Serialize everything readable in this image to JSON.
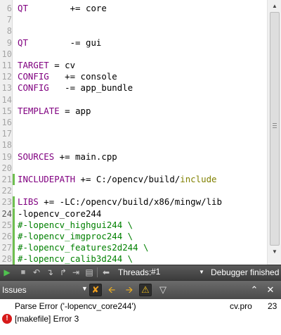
{
  "editor": {
    "lines": [
      {
        "num": "6",
        "segments": [
          {
            "t": "QT",
            "c": "kw"
          },
          {
            "t": "        += core",
            "c": "path"
          }
        ]
      },
      {
        "num": "7",
        "segments": []
      },
      {
        "num": "8",
        "segments": []
      },
      {
        "num": "9",
        "segments": [
          {
            "t": "QT",
            "c": "kw"
          },
          {
            "t": "        -= gui",
            "c": "path"
          }
        ]
      },
      {
        "num": "10",
        "segments": []
      },
      {
        "num": "11",
        "segments": [
          {
            "t": "TARGET",
            "c": "kw"
          },
          {
            "t": " = cv",
            "c": "path"
          }
        ]
      },
      {
        "num": "12",
        "segments": [
          {
            "t": "CONFIG",
            "c": "kw"
          },
          {
            "t": "   += console",
            "c": "path"
          }
        ]
      },
      {
        "num": "13",
        "segments": [
          {
            "t": "CONFIG",
            "c": "kw"
          },
          {
            "t": "   -= app_bundle",
            "c": "path"
          }
        ]
      },
      {
        "num": "14",
        "segments": []
      },
      {
        "num": "15",
        "segments": [
          {
            "t": "TEMPLATE",
            "c": "kw"
          },
          {
            "t": " = app",
            "c": "path"
          }
        ]
      },
      {
        "num": "16",
        "segments": []
      },
      {
        "num": "17",
        "segments": []
      },
      {
        "num": "18",
        "segments": []
      },
      {
        "num": "19",
        "segments": [
          {
            "t": "SOURCES",
            "c": "kw"
          },
          {
            "t": " += main.cpp",
            "c": "path"
          }
        ]
      },
      {
        "num": "20",
        "segments": []
      },
      {
        "num": "21",
        "modified": true,
        "segments": [
          {
            "t": "INCLUDEPATH",
            "c": "kw"
          },
          {
            "t": " += C:/opencv/build/",
            "c": "path"
          },
          {
            "t": "include",
            "c": "inc"
          }
        ]
      },
      {
        "num": "22",
        "segments": []
      },
      {
        "num": "23",
        "modified": true,
        "segments": [
          {
            "t": "LIBS",
            "c": "kw"
          },
          {
            "t": " += -LC:/opencv/build/x86/mingw/lib",
            "c": "path"
          }
        ]
      },
      {
        "num": "24",
        "modified": true,
        "current": true,
        "segments": [
          {
            "t": "-lopencv_core244",
            "c": "path"
          }
        ]
      },
      {
        "num": "25",
        "modified": true,
        "segments": [
          {
            "t": "#-lopencv_highgui244 \\",
            "c": "cm"
          }
        ]
      },
      {
        "num": "26",
        "modified": true,
        "segments": [
          {
            "t": "#-lopencv_imgproc244 \\",
            "c": "cm"
          }
        ]
      },
      {
        "num": "27",
        "modified": true,
        "segments": [
          {
            "t": "#-lopencv_features2d244 \\",
            "c": "cm"
          }
        ]
      },
      {
        "num": "28",
        "modified": true,
        "segments": [
          {
            "t": "#-lopencv_calib3d244 \\",
            "c": "cm"
          }
        ]
      }
    ]
  },
  "debug_toolbar": {
    "threads_label": "Threads:",
    "threads_value": "#1",
    "status": "Debugger finished"
  },
  "issues": {
    "title": "Issues",
    "rows": [
      {
        "description": "Parse Error ('-lopencv_core244')",
        "file": "cv.pro",
        "line": "23",
        "icon": "none"
      },
      {
        "description": "[makefile] Error 3",
        "file": "",
        "line": "",
        "icon": "error-icon"
      }
    ]
  },
  "colors": {
    "keyword": "#800080",
    "include": "#808000",
    "comment": "#008000",
    "modified_marker": "#6fbf50",
    "error": "#d71a1a"
  }
}
